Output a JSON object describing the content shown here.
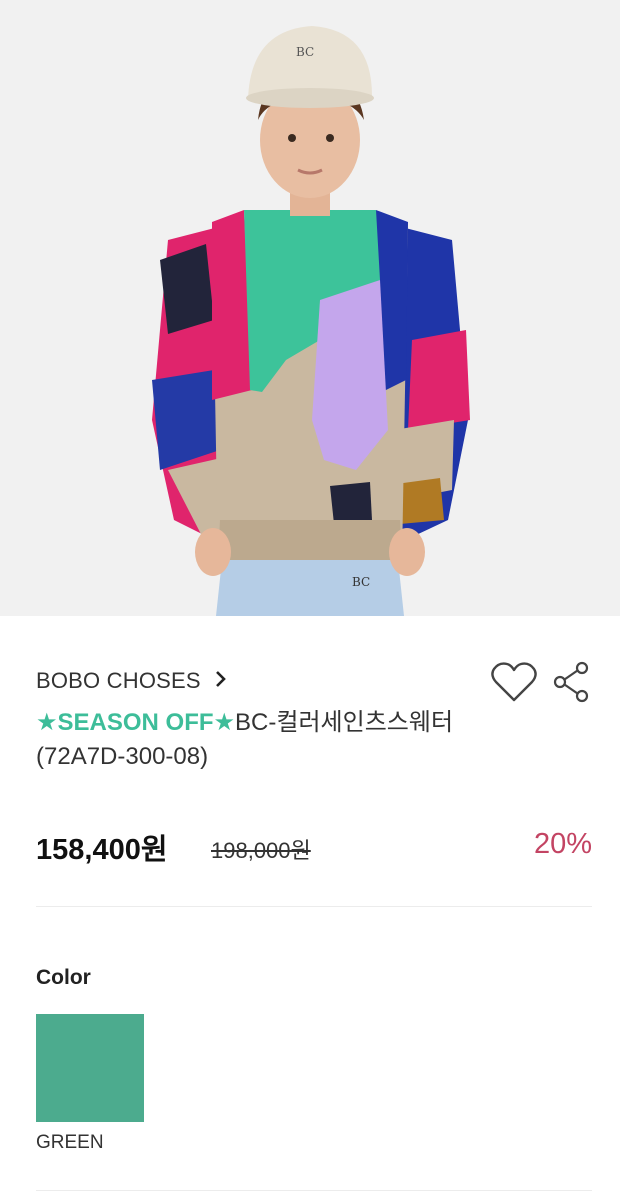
{
  "product": {
    "brand": "BOBO CHOSES",
    "brand_chevron": "›",
    "title_promo": "★SEASON OFF★",
    "title_rest": "BC-컬러세인츠스웨터 (72A7D-300-08)",
    "price": "158,400원",
    "original_price": "198,000원",
    "discount": "20%",
    "hat_text": "BC",
    "pants_text": "BC"
  },
  "options": {
    "color_label": "Color",
    "colors": [
      {
        "name": "GREEN",
        "hex": "#4cab8e"
      }
    ]
  },
  "icons": {
    "wishlist": "heart-icon",
    "share": "share-icon",
    "brand_link": "chevron-right-icon"
  },
  "theme": {
    "promo_color": "#3dbd99",
    "discount_color": "#c34463",
    "image_bg": "#f1f1f1"
  }
}
